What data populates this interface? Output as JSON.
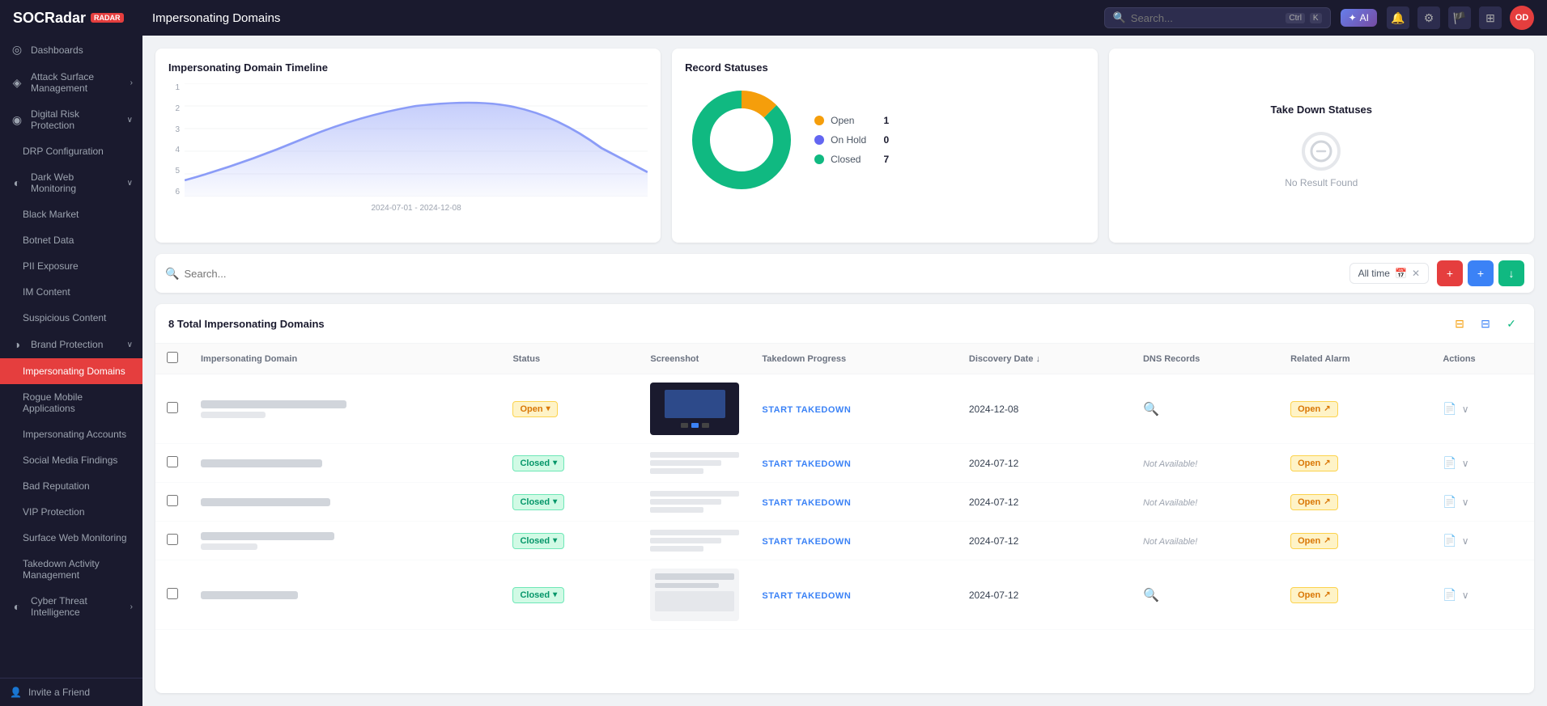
{
  "topbar": {
    "logo": "SOCRadar",
    "title": "Impersonating Domains",
    "search_placeholder": "Search...",
    "search_key1": "Ctrl",
    "search_key2": "K",
    "ai_label": "AI",
    "avatar_initials": "OD"
  },
  "sidebar": {
    "items": [
      {
        "id": "dashboards",
        "label": "Dashboards",
        "icon": "◎",
        "active": false,
        "sub": false
      },
      {
        "id": "attack-surface",
        "label": "Attack Surface Management",
        "icon": "◈",
        "active": false,
        "sub": true
      },
      {
        "id": "digital-risk",
        "label": "Digital Risk Protection",
        "icon": "◉",
        "active": false,
        "sub": true
      },
      {
        "id": "drp-config",
        "label": "DRP Configuration",
        "icon": "⚙",
        "active": false,
        "sub": false,
        "indent": true
      },
      {
        "id": "dark-web",
        "label": "Dark Web Monitoring",
        "icon": "◐",
        "active": false,
        "sub": true
      },
      {
        "id": "black-market",
        "label": "Black Market",
        "icon": "●",
        "active": false,
        "sub": false,
        "indent": true
      },
      {
        "id": "botnet-data",
        "label": "Botnet Data",
        "icon": "◆",
        "active": false,
        "sub": false,
        "indent": true
      },
      {
        "id": "pii-exposure",
        "label": "PII Exposure",
        "icon": "◇",
        "active": false,
        "sub": false,
        "indent": true
      },
      {
        "id": "im-content",
        "label": "IM Content",
        "icon": "▣",
        "active": false,
        "sub": false,
        "indent": true
      },
      {
        "id": "suspicious",
        "label": "Suspicious Content",
        "icon": "▤",
        "active": false,
        "sub": false,
        "indent": true
      },
      {
        "id": "brand-protection",
        "label": "Brand Protection",
        "icon": "◑",
        "active": false,
        "sub": true
      },
      {
        "id": "impersonating-domains",
        "label": "Impersonating Domains",
        "icon": "↕",
        "active": true,
        "sub": false,
        "indent": true
      },
      {
        "id": "rogue-mobile",
        "label": "Rogue Mobile Applications",
        "icon": "⚙",
        "active": false,
        "sub": false,
        "indent": true
      },
      {
        "id": "impersonating-accounts",
        "label": "Impersonating Accounts",
        "icon": "👤",
        "active": false,
        "sub": false,
        "indent": true
      },
      {
        "id": "social-media",
        "label": "Social Media Findings",
        "icon": "▦",
        "active": false,
        "sub": false,
        "indent": true
      },
      {
        "id": "bad-reputation",
        "label": "Bad Reputation",
        "icon": "◎",
        "active": false,
        "sub": false,
        "indent": true
      },
      {
        "id": "vip-protection",
        "label": "VIP Protection",
        "icon": "◈",
        "active": false,
        "sub": false,
        "indent": true
      },
      {
        "id": "surface-web",
        "label": "Surface Web Monitoring",
        "icon": "◉",
        "active": false,
        "sub": false,
        "indent": true
      },
      {
        "id": "takedown",
        "label": "Takedown Activity Management",
        "icon": "⊕",
        "active": false,
        "sub": false,
        "indent": true
      },
      {
        "id": "cyber-threat",
        "label": "Cyber Threat Intelligence",
        "icon": "◐",
        "active": false,
        "sub": true
      }
    ],
    "footer_label": "Invite a Friend"
  },
  "summary_cards": {
    "timeline": {
      "title": "Impersonating Domain Timeline",
      "date_range": "2024-07-01 - 2024-12-08",
      "y_labels": [
        "1",
        "2",
        "3",
        "4",
        "5",
        "6"
      ],
      "color": "#8b9cf7"
    },
    "record_statuses": {
      "title": "Record Statuses",
      "legend": [
        {
          "label": "Open",
          "count": 1,
          "color": "#f59e0b"
        },
        {
          "label": "On Hold",
          "count": 0,
          "color": "#6366f1"
        },
        {
          "label": "Closed",
          "count": 7,
          "color": "#10b981"
        }
      ]
    },
    "takedown_statuses": {
      "title": "Take Down Statuses",
      "no_result": "No Result Found"
    }
  },
  "filter": {
    "search_placeholder": "Search...",
    "date_label": "All time",
    "btn_red_icon": "+",
    "btn_blue_icon": "+",
    "btn_green_icon": "↓"
  },
  "table": {
    "total_label": "8 Total Impersonating Domains",
    "columns": [
      "Impersonating Domain",
      "Status",
      "Screenshot",
      "Takedown Progress",
      "Discovery Date",
      "DNS Records",
      "Related Alarm",
      "Actions"
    ],
    "rows": [
      {
        "domain": "██████████████ ████ ███",
        "subdomain": "██████ ████",
        "status": "Open",
        "status_type": "open",
        "has_screenshot": true,
        "screenshot_type": "dark",
        "takedown": "START TAKEDOWN",
        "discovery_date": "2024-12-08",
        "dns": "search",
        "alarm": "Open",
        "alarm_type": "open"
      },
      {
        "domain": "████████████████",
        "subdomain": "",
        "status": "Closed",
        "status_type": "closed",
        "has_screenshot": false,
        "screenshot_type": "blurred",
        "takedown": "START TAKEDOWN",
        "discovery_date": "2024-07-12",
        "dns": "Not Available!",
        "alarm": "Open",
        "alarm_type": "open"
      },
      {
        "domain": "████████████████████",
        "subdomain": "",
        "status": "Closed",
        "status_type": "closed",
        "has_screenshot": false,
        "screenshot_type": "blurred",
        "takedown": "START TAKEDOWN",
        "discovery_date": "2024-07-12",
        "dns": "Not Available!",
        "alarm": "Open",
        "alarm_type": "open"
      },
      {
        "domain": "█████████████████████",
        "subdomain": "",
        "status": "Closed",
        "status_type": "closed",
        "has_screenshot": false,
        "screenshot_type": "blurred",
        "takedown": "START TAKEDOWN",
        "discovery_date": "2024-07-12",
        "dns": "Not Available!",
        "alarm": "Open",
        "alarm_type": "open"
      },
      {
        "domain": "████████████",
        "subdomain": "",
        "status": "Closed",
        "status_type": "closed",
        "has_screenshot": true,
        "screenshot_type": "light",
        "takedown": "START TAKEDOWN",
        "discovery_date": "2024-07-12",
        "dns": "search",
        "alarm": "Open",
        "alarm_type": "open"
      }
    ]
  },
  "colors": {
    "open": "#f59e0b",
    "closed": "#10b981",
    "on_hold": "#6366f1",
    "primary": "#e53e3e",
    "sidebar_bg": "#1a1a2e",
    "active_nav": "#e53e3e"
  }
}
